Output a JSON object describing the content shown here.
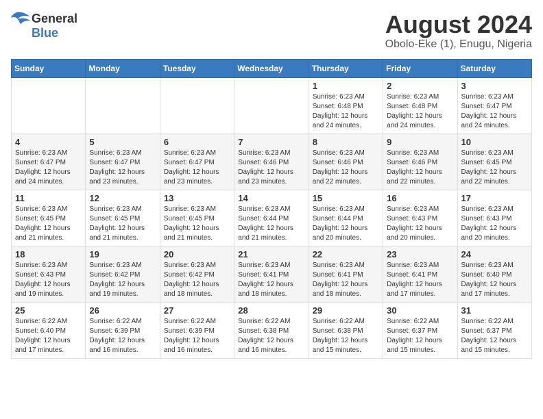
{
  "logo": {
    "general": "General",
    "blue": "Blue"
  },
  "title": "August 2024",
  "subtitle": "Obolo-Eke (1), Enugu, Nigeria",
  "days_of_week": [
    "Sunday",
    "Monday",
    "Tuesday",
    "Wednesday",
    "Thursday",
    "Friday",
    "Saturday"
  ],
  "weeks": [
    [
      {
        "day": "",
        "info": ""
      },
      {
        "day": "",
        "info": ""
      },
      {
        "day": "",
        "info": ""
      },
      {
        "day": "",
        "info": ""
      },
      {
        "day": "1",
        "info": "Sunrise: 6:23 AM\nSunset: 6:48 PM\nDaylight: 12 hours\nand 24 minutes."
      },
      {
        "day": "2",
        "info": "Sunrise: 6:23 AM\nSunset: 6:48 PM\nDaylight: 12 hours\nand 24 minutes."
      },
      {
        "day": "3",
        "info": "Sunrise: 6:23 AM\nSunset: 6:47 PM\nDaylight: 12 hours\nand 24 minutes."
      }
    ],
    [
      {
        "day": "4",
        "info": "Sunrise: 6:23 AM\nSunset: 6:47 PM\nDaylight: 12 hours\nand 24 minutes."
      },
      {
        "day": "5",
        "info": "Sunrise: 6:23 AM\nSunset: 6:47 PM\nDaylight: 12 hours\nand 23 minutes."
      },
      {
        "day": "6",
        "info": "Sunrise: 6:23 AM\nSunset: 6:47 PM\nDaylight: 12 hours\nand 23 minutes."
      },
      {
        "day": "7",
        "info": "Sunrise: 6:23 AM\nSunset: 6:46 PM\nDaylight: 12 hours\nand 23 minutes."
      },
      {
        "day": "8",
        "info": "Sunrise: 6:23 AM\nSunset: 6:46 PM\nDaylight: 12 hours\nand 22 minutes."
      },
      {
        "day": "9",
        "info": "Sunrise: 6:23 AM\nSunset: 6:46 PM\nDaylight: 12 hours\nand 22 minutes."
      },
      {
        "day": "10",
        "info": "Sunrise: 6:23 AM\nSunset: 6:45 PM\nDaylight: 12 hours\nand 22 minutes."
      }
    ],
    [
      {
        "day": "11",
        "info": "Sunrise: 6:23 AM\nSunset: 6:45 PM\nDaylight: 12 hours\nand 21 minutes."
      },
      {
        "day": "12",
        "info": "Sunrise: 6:23 AM\nSunset: 6:45 PM\nDaylight: 12 hours\nand 21 minutes."
      },
      {
        "day": "13",
        "info": "Sunrise: 6:23 AM\nSunset: 6:45 PM\nDaylight: 12 hours\nand 21 minutes."
      },
      {
        "day": "14",
        "info": "Sunrise: 6:23 AM\nSunset: 6:44 PM\nDaylight: 12 hours\nand 21 minutes."
      },
      {
        "day": "15",
        "info": "Sunrise: 6:23 AM\nSunset: 6:44 PM\nDaylight: 12 hours\nand 20 minutes."
      },
      {
        "day": "16",
        "info": "Sunrise: 6:23 AM\nSunset: 6:43 PM\nDaylight: 12 hours\nand 20 minutes."
      },
      {
        "day": "17",
        "info": "Sunrise: 6:23 AM\nSunset: 6:43 PM\nDaylight: 12 hours\nand 20 minutes."
      }
    ],
    [
      {
        "day": "18",
        "info": "Sunrise: 6:23 AM\nSunset: 6:43 PM\nDaylight: 12 hours\nand 19 minutes."
      },
      {
        "day": "19",
        "info": "Sunrise: 6:23 AM\nSunset: 6:42 PM\nDaylight: 12 hours\nand 19 minutes."
      },
      {
        "day": "20",
        "info": "Sunrise: 6:23 AM\nSunset: 6:42 PM\nDaylight: 12 hours\nand 18 minutes."
      },
      {
        "day": "21",
        "info": "Sunrise: 6:23 AM\nSunset: 6:41 PM\nDaylight: 12 hours\nand 18 minutes."
      },
      {
        "day": "22",
        "info": "Sunrise: 6:23 AM\nSunset: 6:41 PM\nDaylight: 12 hours\nand 18 minutes."
      },
      {
        "day": "23",
        "info": "Sunrise: 6:23 AM\nSunset: 6:41 PM\nDaylight: 12 hours\nand 17 minutes."
      },
      {
        "day": "24",
        "info": "Sunrise: 6:23 AM\nSunset: 6:40 PM\nDaylight: 12 hours\nand 17 minutes."
      }
    ],
    [
      {
        "day": "25",
        "info": "Sunrise: 6:22 AM\nSunset: 6:40 PM\nDaylight: 12 hours\nand 17 minutes."
      },
      {
        "day": "26",
        "info": "Sunrise: 6:22 AM\nSunset: 6:39 PM\nDaylight: 12 hours\nand 16 minutes."
      },
      {
        "day": "27",
        "info": "Sunrise: 6:22 AM\nSunset: 6:39 PM\nDaylight: 12 hours\nand 16 minutes."
      },
      {
        "day": "28",
        "info": "Sunrise: 6:22 AM\nSunset: 6:38 PM\nDaylight: 12 hours\nand 16 minutes."
      },
      {
        "day": "29",
        "info": "Sunrise: 6:22 AM\nSunset: 6:38 PM\nDaylight: 12 hours\nand 15 minutes."
      },
      {
        "day": "30",
        "info": "Sunrise: 6:22 AM\nSunset: 6:37 PM\nDaylight: 12 hours\nand 15 minutes."
      },
      {
        "day": "31",
        "info": "Sunrise: 6:22 AM\nSunset: 6:37 PM\nDaylight: 12 hours\nand 15 minutes."
      }
    ]
  ]
}
